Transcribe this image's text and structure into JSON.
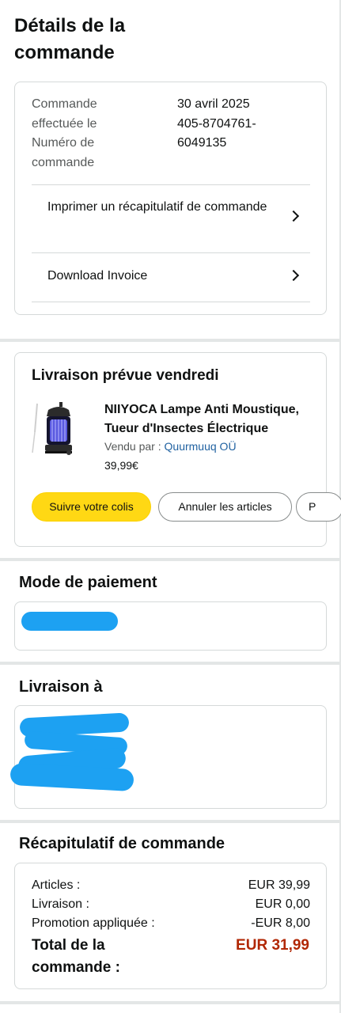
{
  "page": {
    "title": "Détails de la commande"
  },
  "order": {
    "date_label": "Commande effectuée le",
    "number_label": "Numéro de commande",
    "date_value": "30 avril 2025",
    "number_value": "405-8704761-6049135",
    "print_label": "Imprimer un récapitulatif de commande",
    "invoice_label": "Download Invoice"
  },
  "shipment": {
    "heading": "Livraison prévue vendredi",
    "product_name": "NIIYOCA Lampe Anti Moustique, Tueur d'Insectes Électrique",
    "seller_prefix": "Vendu par  : ",
    "seller_name": "Quurmuuq OÜ",
    "price": "39,99€",
    "buttons": {
      "track": "Suivre votre colis",
      "cancel": "Annuler les articles",
      "more": "P"
    }
  },
  "payment": {
    "heading": "Mode de paiement"
  },
  "delivery": {
    "heading": "Livraison à"
  },
  "summary": {
    "heading": "Récapitulatif de commande",
    "rows": [
      {
        "label": "Articles :",
        "value": "EUR 39,99"
      },
      {
        "label": "Livraison :",
        "value": "EUR 0,00"
      },
      {
        "label": "Promotion appliquée :",
        "value": "-EUR 8,00"
      }
    ],
    "total_label": "Total de la commande :",
    "total_value": "EUR 31,99"
  },
  "colors": {
    "accent_yellow": "#ffd814",
    "total_red": "#b12704",
    "link_blue": "#2162a1",
    "redaction_blue": "#1da1f2"
  },
  "icons": [
    "chevron-right-icon",
    "chevron-right-icon",
    "product-thumbnail"
  ]
}
